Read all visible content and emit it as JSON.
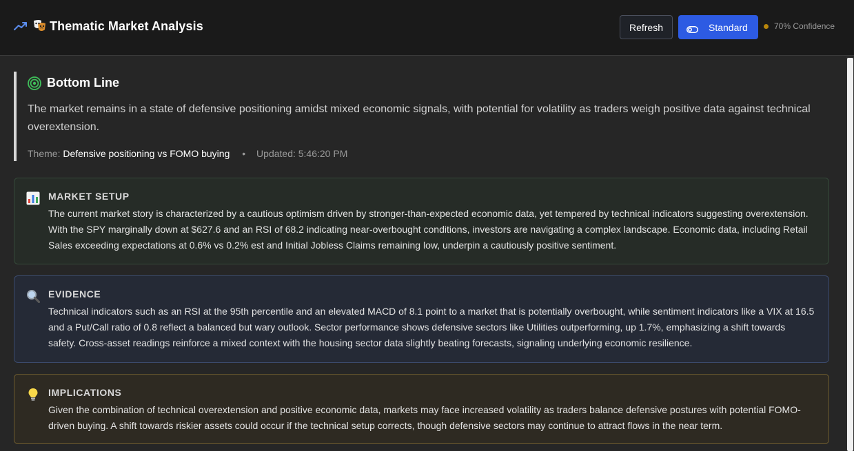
{
  "header": {
    "title": "Thematic Market Analysis",
    "refresh_label": "Refresh",
    "mode_label": "Standard",
    "confidence": "70% Confidence",
    "icons": [
      "trending-up-icon",
      "mask-icon",
      "toggle-icon"
    ],
    "accent_color": "#2d5be3",
    "confidence_dot_color": "#b8860b"
  },
  "bottom_line": {
    "title": "Bottom Line",
    "icon": "target-icon",
    "text": "The market remains in a state of defensive positioning amidst mixed economic signals, with potential for volatility as traders weigh positive data against technical overextension.",
    "theme_label": "Theme:",
    "theme_value": "Defensive positioning vs FOMO buying",
    "separator": "•",
    "updated": "Updated: 5:46:20 PM"
  },
  "cards": [
    {
      "icon": "bar-chart-icon",
      "title": "MARKET SETUP",
      "text": "The current market story is characterized by a cautious optimism driven by stronger-than-expected economic data, yet tempered by technical indicators suggesting overextension. With the SPY marginally down at $627.6 and an RSI of 68.2 indicating near-overbought conditions, investors are navigating a complex landscape. Economic data, including Retail Sales exceeding expectations at 0.6% vs 0.2% est and Initial Jobless Claims remaining low, underpin a cautiously positive sentiment."
    },
    {
      "icon": "magnifier-icon",
      "title": "EVIDENCE",
      "text": "Technical indicators such as an RSI at the 95th percentile and an elevated MACD of 8.1 point to a market that is potentially overbought, while sentiment indicators like a VIX at 16.5 and a Put/Call ratio of 0.8 reflect a balanced but wary outlook. Sector performance shows defensive sectors like Utilities outperforming, up 1.7%, emphasizing a shift towards safety. Cross-asset readings reinforce a mixed context with the housing sector data slightly beating forecasts, signaling underlying economic resilience."
    },
    {
      "icon": "lightbulb-icon",
      "title": "IMPLICATIONS",
      "text": "Given the combination of technical overextension and positive economic data, markets may face increased volatility as traders balance defensive postures with potential FOMO-driven buying. A shift towards riskier assets could occur if the technical setup corrects, though defensive sectors may continue to attract flows in the near term."
    }
  ]
}
